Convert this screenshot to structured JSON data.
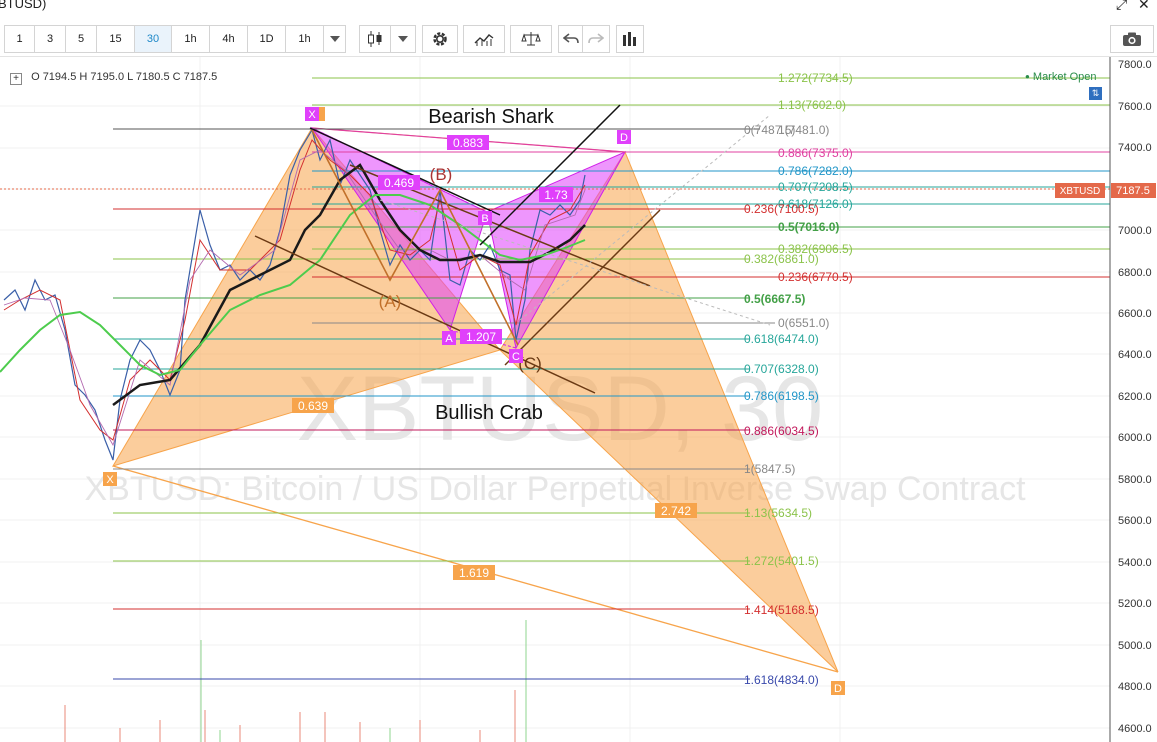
{
  "window": {
    "title": "BTUSD)"
  },
  "toolbar": {
    "intervals": [
      "1",
      "3",
      "5",
      "15",
      "30",
      "1h",
      "4h",
      "1D",
      "1h"
    ],
    "active_interval": "30"
  },
  "ohlc": {
    "o_label": "O",
    "o": "7194.5",
    "h_label": "H",
    "h": "7195.0",
    "l_label": "L",
    "l": "7180.5",
    "c_label": "C",
    "c": "7187.5"
  },
  "market_status": "Market Open",
  "watermark": {
    "symbol": "XBTUSD, 30",
    "description": "XBTUSD: Bitcoin / US Dollar Perpetual Inverse Swap Contract"
  },
  "price_badge": {
    "symbol": "XBTUSD",
    "price": "7187.5"
  },
  "price_axis": [
    "7800.0",
    "7600.0",
    "7400.0",
    "7200.0",
    "7000.0",
    "6800.0",
    "6600.0",
    "6400.0",
    "6200.0",
    "6000.0",
    "5800.0",
    "5600.0",
    "5400.0",
    "5200.0",
    "5000.0",
    "4800.0",
    "4600.0"
  ],
  "annotations": {
    "bearish_shark": "Bearish Shark",
    "bullish_crab": "Bullish Crab",
    "pt_x_top": "X",
    "pt_a": "A",
    "pt_b": "B",
    "pt_c": "C",
    "pt_d_top": "D",
    "pt_x_bottom": "X",
    "pt_d_bottom": "D",
    "paren_a": "(A)",
    "paren_b": "(B)",
    "paren_c": "(C)",
    "r_0883": "0.883",
    "r_0469": "0.469",
    "r_173": "1.73",
    "r_1207": "1.207",
    "r_0639": "0.639",
    "r_2742": "2.742",
    "r_1619": "1.619"
  },
  "fib_levels": [
    {
      "label": "1.272(7734.5)",
      "color": "#8bc34a"
    },
    {
      "label": "1.13(7602.0)",
      "color": "#8bc34a"
    },
    {
      "label": "0(7487.5)",
      "color": "#888888"
    },
    {
      "label": "1(7481.0)",
      "color": "#888888"
    },
    {
      "label": "0.886(7375.0)",
      "color": "#e040a0"
    },
    {
      "label": "0.786(7282.0)",
      "color": "#2196c8"
    },
    {
      "label": "0.707(7208.5)",
      "color": "#26a69a"
    },
    {
      "label": "0.618(7126.0)",
      "color": "#26a69a"
    },
    {
      "label": "0.236(7100.5)",
      "color": "#d32f2f"
    },
    {
      "label": "0.5(7016.0)",
      "color": "#43a047"
    },
    {
      "label": "0.382(6906.5)",
      "color": "#8bc34a"
    },
    {
      "label": "0.382(6861.0)",
      "color": "#8bc34a"
    },
    {
      "label": "0.236(6770.5)",
      "color": "#d32f2f"
    },
    {
      "label": "0.5(6667.5)",
      "color": "#43a047"
    },
    {
      "label": "0(6551.0)",
      "color": "#888888"
    },
    {
      "label": "0.618(6474.0)",
      "color": "#26a69a"
    },
    {
      "label": "0.707(6328.0)",
      "color": "#26a69a"
    },
    {
      "label": "0.786(6198.5)",
      "color": "#2196c8"
    },
    {
      "label": "0.886(6034.5)",
      "color": "#c2185b"
    },
    {
      "label": "1(5847.5)",
      "color": "#888888"
    },
    {
      "label": "1.13(5634.5)",
      "color": "#8bc34a"
    },
    {
      "label": "1.272(5401.5)",
      "color": "#8bc34a"
    },
    {
      "label": "1.414(5168.5)",
      "color": "#d32f2f"
    },
    {
      "label": "1.618(4834.0)",
      "color": "#3949ab"
    }
  ],
  "colors": {
    "orange": "#f7a44b",
    "magenta": "#e040fb",
    "accent": "#1e88c8",
    "red_badge": "#e4694a"
  }
}
